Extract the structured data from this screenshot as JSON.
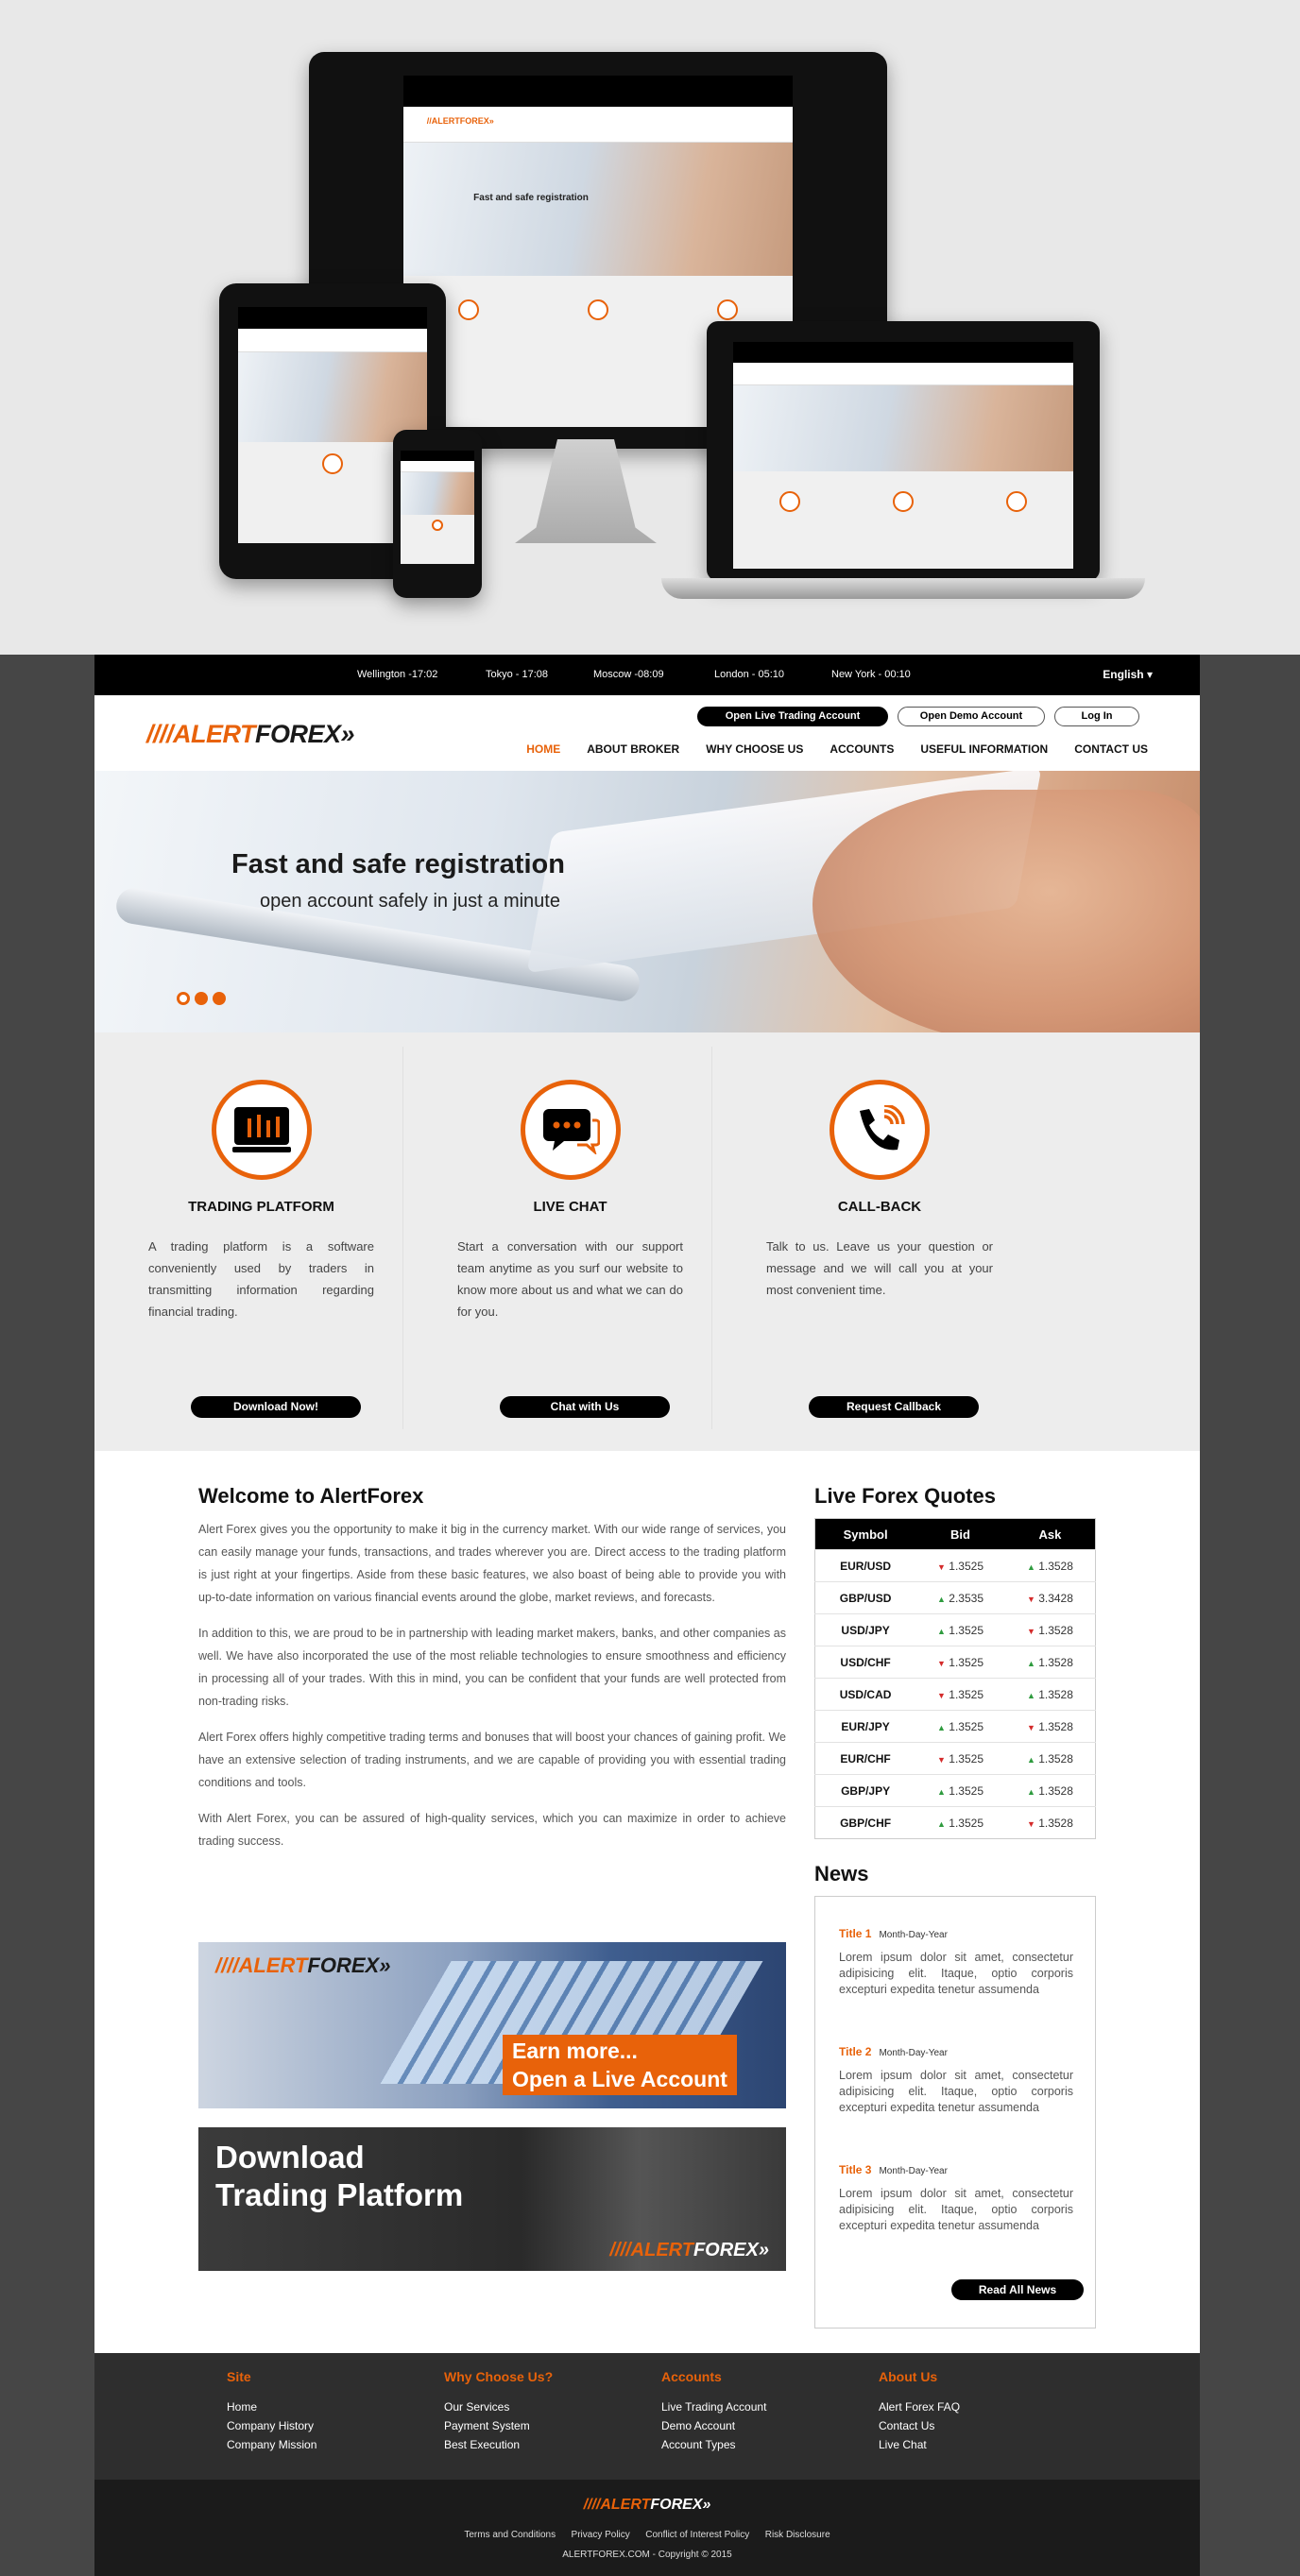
{
  "mockup": {
    "mini_logo": "//ALERTFOREX»",
    "mini_title": "Fast and safe registration"
  },
  "topbar": {
    "clocks": [
      {
        "label": "Wellington -17:02"
      },
      {
        "label": "Tokyo - 17:08"
      },
      {
        "label": "Moscow -08:09"
      },
      {
        "label": "London - 05:10"
      },
      {
        "label": "New York - 00:10"
      }
    ],
    "language": "English ▾"
  },
  "header": {
    "logo_slash": "////",
    "logo_alert": "ALERT",
    "logo_forex": "FOREX",
    "logo_arrows": "»",
    "open_live": "Open Live Trading Account",
    "open_demo": "Open Demo Account",
    "login": "Log In",
    "nav": [
      "HOME",
      "ABOUT BROKER",
      "WHY CHOOSE US",
      "ACCOUNTS",
      "USEFUL INFORMATION",
      "CONTACT US"
    ]
  },
  "hero": {
    "title": "Fast and safe registration",
    "subtitle": "open account safely in just a minute"
  },
  "features": [
    {
      "icon": "trading-chart-icon",
      "title": "TRADING PLATFORM",
      "text": "A trading platform is a software conveniently used by traders in transmitting information regarding financial trading.",
      "button": "Download Now!"
    },
    {
      "icon": "chat-bubbles-icon",
      "title": "LIVE CHAT",
      "text": "Start a conversation with our support team anytime as you surf our website to know more about us and what we can do for you.",
      "button": "Chat with Us"
    },
    {
      "icon": "phone-callback-icon",
      "title": "CALL-BACK",
      "text": "Talk to us. Leave us your question or message and we will call you at your most convenient time.",
      "button": "Request Callback"
    }
  ],
  "welcome": {
    "title": "Welcome to AlertForex",
    "paragraphs": [
      "Alert Forex gives you the opportunity to make it big in the currency market. With our wide range of services, you can easily manage your funds, transactions, and trades wherever you are. Direct access to the trading platform is just right at your fingertips. Aside from these basic features, we also boast of being able to provide you with up-to-date information on various financial events around the globe, market reviews, and forecasts.",
      "In addition to this, we are proud to be in partnership with leading market makers, banks, and other companies as well. We have also incorporated the use of the most reliable technologies to ensure smoothness and efficiency in processing all of your trades. With this in mind, you can be confident that your funds are well protected from non-trading risks.",
      "Alert Forex offers highly competitive trading terms and bonuses that will boost your chances of gaining profit. We have an extensive selection of trading instruments, and we are capable of providing you with essential trading conditions and tools.",
      "With Alert Forex, you can be assured of high-quality services, which you can maximize in order to achieve trading success."
    ]
  },
  "banners": {
    "earn_line1": "Earn more...",
    "earn_line2": "Open a Live Account",
    "download_line1": "Download",
    "download_line2": "Trading Platform"
  },
  "quotes": {
    "title": "Live Forex Quotes",
    "headers": [
      "Symbol",
      "Bid",
      "Ask"
    ],
    "rows": [
      {
        "symbol": "EUR/USD",
        "bid": "1.3525",
        "bid_dir": "down",
        "ask": "1.3528",
        "ask_dir": "up"
      },
      {
        "symbol": "GBP/USD",
        "bid": "2.3535",
        "bid_dir": "up",
        "ask": "3.3428",
        "ask_dir": "down"
      },
      {
        "symbol": "USD/JPY",
        "bid": "1.3525",
        "bid_dir": "up",
        "ask": "1.3528",
        "ask_dir": "down"
      },
      {
        "symbol": "USD/CHF",
        "bid": "1.3525",
        "bid_dir": "down",
        "ask": "1.3528",
        "ask_dir": "up"
      },
      {
        "symbol": "USD/CAD",
        "bid": "1.3525",
        "bid_dir": "down",
        "ask": "1.3528",
        "ask_dir": "up"
      },
      {
        "symbol": "EUR/JPY",
        "bid": "1.3525",
        "bid_dir": "up",
        "ask": "1.3528",
        "ask_dir": "down"
      },
      {
        "symbol": "EUR/CHF",
        "bid": "1.3525",
        "bid_dir": "down",
        "ask": "1.3528",
        "ask_dir": "up"
      },
      {
        "symbol": "GBP/JPY",
        "bid": "1.3525",
        "bid_dir": "up",
        "ask": "1.3528",
        "ask_dir": "up"
      },
      {
        "symbol": "GBP/CHF",
        "bid": "1.3525",
        "bid_dir": "up",
        "ask": "1.3528",
        "ask_dir": "down"
      }
    ]
  },
  "news": {
    "title": "News",
    "items": [
      {
        "title": "Title 1",
        "date": "Month-Day-Year",
        "text": "Lorem ipsum dolor sit amet, consectetur adipisicing elit. Itaque, optio corporis excepturi expedita tenetur assumenda"
      },
      {
        "title": "Title 2",
        "date": "Month-Day-Year",
        "text": "Lorem ipsum dolor sit amet, consectetur adipisicing elit. Itaque, optio corporis excepturi expedita tenetur assumenda"
      },
      {
        "title": "Title 3",
        "date": "Month-Day-Year",
        "text": "Lorem ipsum dolor sit amet, consectetur adipisicing elit. Itaque, optio corporis excepturi expedita tenetur assumenda"
      }
    ],
    "read_all": "Read All News"
  },
  "footer": {
    "columns": [
      {
        "title": "Site",
        "links": [
          "Home",
          "Company History",
          "Company Mission"
        ]
      },
      {
        "title": "Why Choose Us?",
        "links": [
          "Our Services",
          "Payment System",
          "Best Execution"
        ]
      },
      {
        "title": "Accounts",
        "links": [
          "Live Trading Account",
          "Demo Account",
          "Account Types"
        ]
      },
      {
        "title": "About Us",
        "links": [
          "Alert Forex FAQ",
          "Contact Us",
          "Live Chat"
        ]
      }
    ],
    "bottom_links": [
      "Terms and Conditions",
      "Privacy Policy",
      "Conflict of Interest Policy",
      "Risk Disclosure"
    ],
    "copyright": "ALERTFOREX.COM - Copyright © 2015"
  },
  "colors": {
    "accent": "#e8620a",
    "black": "#000000",
    "frame": "#464646",
    "quote_up": "#2e9b3e",
    "quote_down": "#d42b2b"
  }
}
